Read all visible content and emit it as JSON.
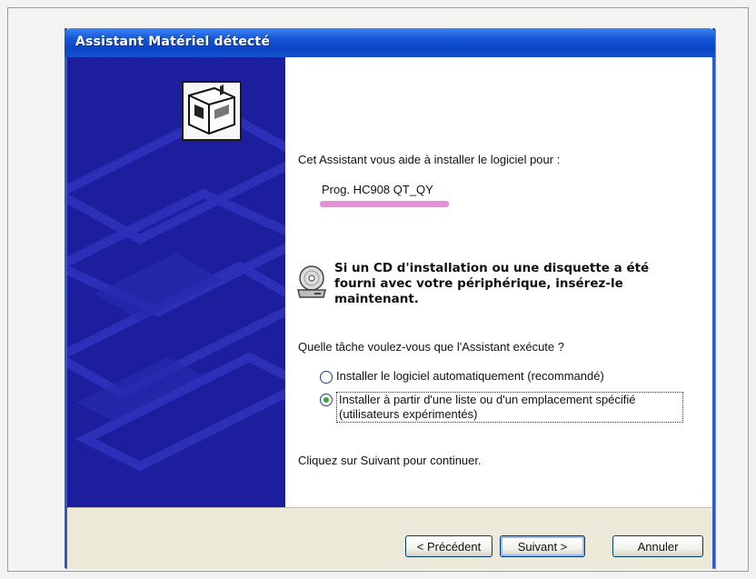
{
  "window": {
    "title": "Assistant Matériel détecté"
  },
  "content": {
    "intro": "Cet Assistant vous aide à installer le logiciel pour :",
    "device_name": "Prog. HC908 QT_QY",
    "cd_prompt": "Si un CD d'installation ou une disquette a été fourni avec votre périphérique, insérez-le maintenant.",
    "question": "Quelle tâche voulez-vous que l'Assistant exécute ?",
    "options": [
      {
        "label": "Installer le logiciel automatiquement (recommandé)",
        "selected": false
      },
      {
        "label": "Installer à partir d'une liste ou d'un emplacement spécifié (utilisateurs expérimentés)",
        "selected": true
      }
    ],
    "continue_hint": "Cliquez sur Suivant pour continuer."
  },
  "buttons": {
    "back": "< Précédent",
    "next": "Suivant >",
    "cancel": "Annuler"
  },
  "icons": {
    "hardware": "hardware-wizard-icon",
    "cd": "cd-drive-icon"
  },
  "colors": {
    "titlebar": "#0a44c4",
    "side_panel": "#1d1e9e",
    "button_bar": "#ece9d8",
    "highlight": "#e27ad0"
  }
}
